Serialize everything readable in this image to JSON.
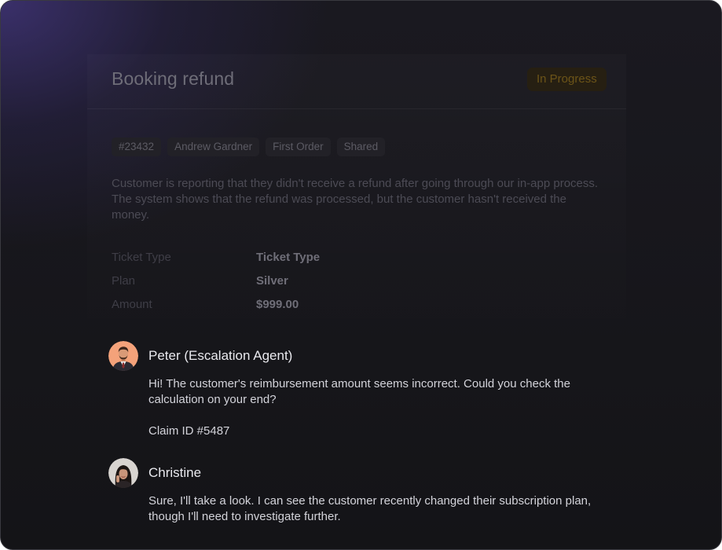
{
  "ticket": {
    "title": "Booking refund",
    "status": "In Progress",
    "tags": [
      "#23432",
      "Andrew Gardner",
      "First Order",
      "Shared"
    ],
    "description": "Customer is reporting that they didn't receive a refund after going through our in-app process. The system shows that the refund was processed, but the customer hasn't received the money.",
    "details": [
      {
        "key": "Ticket Type",
        "value": "Ticket Type"
      },
      {
        "key": "Plan",
        "value": "Silver"
      },
      {
        "key": "Amount",
        "value": "$999.00"
      }
    ]
  },
  "messages": [
    {
      "author": "Peter (Escalation Agent)",
      "avatar_icon": "avatar-man-suit",
      "paragraphs": [
        "Hi! The customer's reimbursement amount seems incorrect. Could you check the calculation on your end?",
        "Claim ID #5487"
      ]
    },
    {
      "author": "Christine",
      "avatar_icon": "avatar-woman",
      "paragraphs": [
        "Sure, I'll take a look. I can see the customer recently changed their subscription plan, though I'll need to investigate further."
      ]
    }
  ],
  "colors": {
    "status_text": "#6c5418",
    "status_bg": "#261f12",
    "background_glow": "#403478"
  }
}
